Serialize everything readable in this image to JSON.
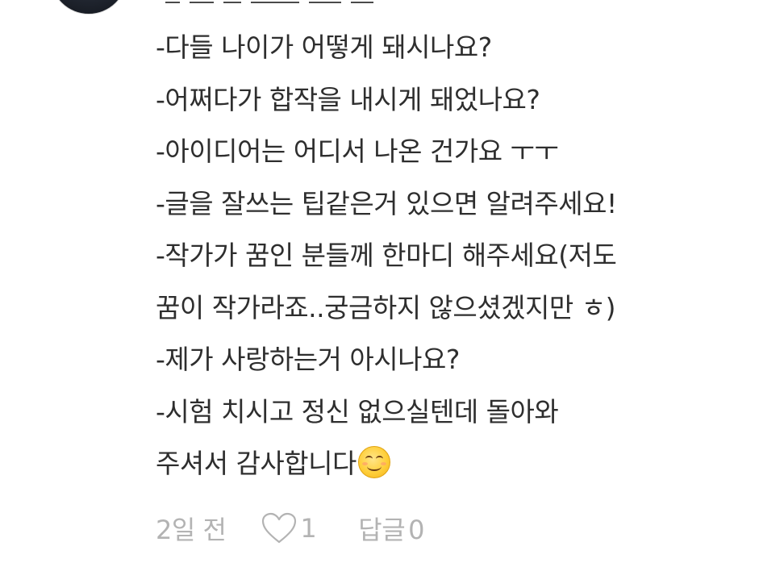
{
  "comment": {
    "lines": [
      "-다들 나이가 어떻게 돼시나요?",
      "-어쩌다가 합작을 내시게 돼었나요?",
      "-아이디어는 어디서 나온 건가요 ㅜㅜ",
      "-글을 잘쓰는 팁같은거 있으면 알려주세요!",
      "-작가가 꿈인 분들께 한마디 해주세요(저도",
      "꿈이 작가라죠..궁금하지 않으셨겠지만 ㅎ)",
      "-제가 사랑하는거 아시나요?",
      "-시험 치시고 정신 없으실텐데 돌아와",
      "주셔서 감사합니다"
    ],
    "emoji": "smiling-face-icon"
  },
  "meta": {
    "time": "2일 전",
    "like_count": "1",
    "reply_label": "답글",
    "reply_count": "0"
  },
  "colors": {
    "text": "#2e2e2e",
    "meta": "#b3b3b3"
  }
}
